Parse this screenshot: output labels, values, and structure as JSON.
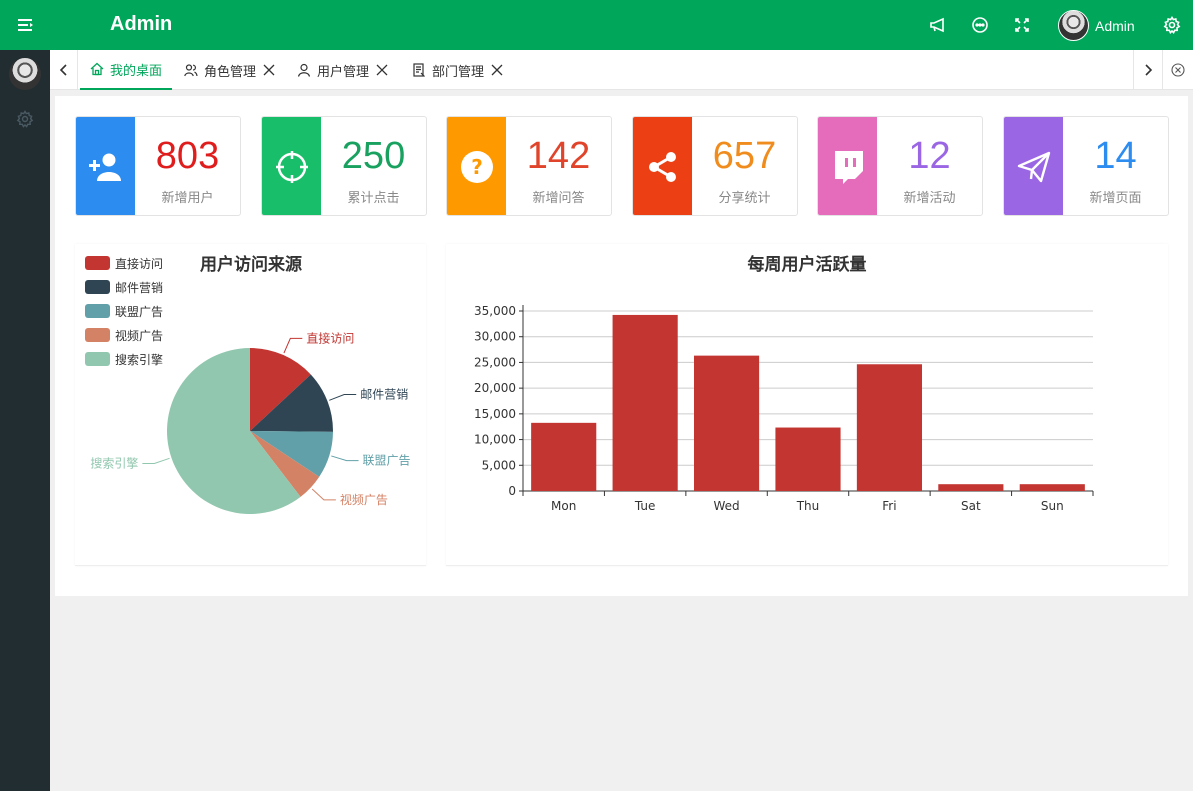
{
  "header": {
    "brand": "Admin",
    "user_name": "Admin",
    "color": "#00a65a",
    "icons": [
      "menu-icon",
      "megaphone-icon",
      "chat-icon",
      "fullscreen-icon",
      "settings-icon"
    ]
  },
  "sidebar": {
    "color": "#222d32",
    "icons": [
      "avatar",
      "gear-icon"
    ]
  },
  "tabs": [
    {
      "label": "我的桌面",
      "icon": "home-icon",
      "active": true,
      "closable": false
    },
    {
      "label": "角色管理",
      "icon": "users-icon",
      "active": false,
      "closable": true
    },
    {
      "label": "用户管理",
      "icon": "user-icon",
      "active": false,
      "closable": true
    },
    {
      "label": "部门管理",
      "icon": "document-icon",
      "active": false,
      "closable": true
    }
  ],
  "stats": [
    {
      "value": "803",
      "label": "新增用户",
      "color": "#2d8cf0",
      "num_color": "#e01d1d",
      "icon": "add-user-icon"
    },
    {
      "value": "250",
      "label": "累计点击",
      "color": "#19be6b",
      "num_color": "#19a15f",
      "icon": "crosshair-icon"
    },
    {
      "value": "142",
      "label": "新增问答",
      "color": "#ff9900",
      "num_color": "#e0442a",
      "icon": "question-icon"
    },
    {
      "value": "657",
      "label": "分享统计",
      "color": "#ed3f14",
      "num_color": "#f08c1d",
      "icon": "share-icon"
    },
    {
      "value": "12",
      "label": "新增活动",
      "color": "#e46cbb",
      "num_color": "#9a66e4",
      "icon": "twitch-icon"
    },
    {
      "value": "14",
      "label": "新增页面",
      "color": "#9a66e4",
      "num_color": "#2d8cf0",
      "icon": "send-icon"
    }
  ],
  "chart_data": [
    {
      "type": "pie",
      "title": "用户访问来源",
      "legend_position": "top-left",
      "categories": [
        "直接访问",
        "邮件营销",
        "联盟广告",
        "视频广告",
        "搜索引擎"
      ],
      "values": [
        335,
        310,
        234,
        135,
        1548
      ],
      "colors": [
        "#c23531",
        "#2f4554",
        "#61a0a8",
        "#d48265",
        "#91c7ae"
      ]
    },
    {
      "type": "bar",
      "title": "每周用户活跃量",
      "categories": [
        "Mon",
        "Tue",
        "Wed",
        "Thu",
        "Fri",
        "Sat",
        "Sun"
      ],
      "values": [
        13253,
        34235,
        26321,
        12340,
        24643,
        1322,
        1324
      ],
      "ylim": [
        0,
        35000
      ],
      "yticks": [
        "0",
        "5,000",
        "10,000",
        "15,000",
        "20,000",
        "25,000",
        "30,000",
        "35,000"
      ],
      "color": "#c23531",
      "grid": true
    }
  ]
}
